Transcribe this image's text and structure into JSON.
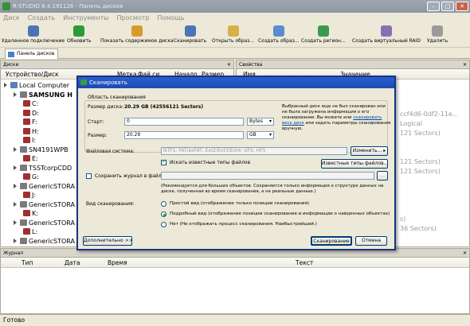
{
  "window": {
    "title": "R-STUDIO 8.4.191126 - Панель дисков",
    "min": "–",
    "max": "□",
    "close": "✕"
  },
  "menu": [
    "Диск",
    "Создать",
    "Инструменты",
    "Просмотр",
    "Помощь"
  ],
  "toolbar": [
    {
      "label": "Удаленное подключение",
      "icon": "remote-connect-icon",
      "color": "#4a74b8"
    },
    {
      "label": "Обновить",
      "icon": "refresh-icon",
      "color": "#2e9b38"
    },
    {
      "label": "Показать содержимое диска",
      "icon": "show-content-icon",
      "color": "#d89a2a"
    },
    {
      "label": "Сканировать",
      "icon": "scan-icon",
      "color": "#4a74b8"
    },
    {
      "label": "Открыть образ...",
      "icon": "open-image-icon",
      "color": "#d6b04a"
    },
    {
      "label": "Создать образ...",
      "icon": "create-image-icon",
      "color": "#5a8cd0"
    },
    {
      "label": "Создать регион...",
      "icon": "create-region-icon",
      "color": "#3c9a4c"
    },
    {
      "label": "Создать виртуальный RAID",
      "icon": "virtual-raid-icon",
      "color": "#8a6fb6"
    },
    {
      "label": "Удалить",
      "icon": "delete-icon",
      "color": "#9a9a9a"
    }
  ],
  "tab": "Панель дисков",
  "disks_pane": {
    "title": "Диски",
    "columns": [
      "Устройство/Диск",
      "Метка",
      "Фай.си.",
      "Начало",
      "Размер"
    ]
  },
  "tree": [
    {
      "label": "Local Computer",
      "level": 0,
      "color": "#5a7fb5"
    },
    {
      "label": "SAMSUNG H",
      "level": 1,
      "color": "#7a7a7a",
      "bold": true
    },
    {
      "label": "C:",
      "level": 2,
      "color": "#a03030"
    },
    {
      "label": "D:",
      "level": 2,
      "color": "#a03030"
    },
    {
      "label": "F:",
      "level": 2,
      "color": "#a03030"
    },
    {
      "label": "H:",
      "level": 2,
      "color": "#a03030"
    },
    {
      "label": "I:",
      "level": 2,
      "color": "#a03030"
    },
    {
      "label": "SN4191WPB",
      "level": 1,
      "color": "#7a7a7a"
    },
    {
      "label": "E:",
      "level": 2,
      "color": "#a03030"
    },
    {
      "label": "TSSTcorpCDD",
      "level": 1,
      "color": "#7a7a7a"
    },
    {
      "label": "G:",
      "level": 2,
      "color": "#a03030"
    },
    {
      "label": "GenericSTORA",
      "level": 1,
      "color": "#7a7a7a"
    },
    {
      "label": "J:",
      "level": 2,
      "color": "#a03030"
    },
    {
      "label": "GenericSTORA",
      "level": 1,
      "color": "#7a7a7a"
    },
    {
      "label": "K:",
      "level": 2,
      "color": "#a03030"
    },
    {
      "label": "GenericSTORA",
      "level": 1,
      "color": "#7a7a7a"
    },
    {
      "label": "L:",
      "level": 2,
      "color": "#a03030"
    },
    {
      "label": "GenericSTORA",
      "level": 1,
      "color": "#7a7a7a"
    }
  ],
  "props_pane": {
    "title": "Свойства",
    "columns": [
      "Имя",
      "Значение"
    ]
  },
  "props_visible": [
    "ccf4d6-0df2-11e...",
    "Logical",
    "121 Sectors)",
    "121 Sectors)",
    "121 Sectors)",
    "s)",
    "36 Sectors)"
  ],
  "journal": {
    "title": "Журнал",
    "columns": [
      "Тип",
      "Дата",
      "Время",
      "Текст"
    ]
  },
  "status": "Готово",
  "dialog": {
    "title": "Сканировать",
    "group_label": "Область сканирования",
    "disk_size_label": "Размер диска:",
    "disk_size_value": "20.29 GB (42556121 Sectors)",
    "start_label": "Старт:",
    "start_value": "0",
    "start_unit": "Bytes",
    "size_label": "Размер:",
    "size_value": "20.29",
    "size_unit": "GB",
    "note_part1": "Выбранный диск еще не был сканирован или не была загружена информация о его сканировании. Вы можете или",
    "note_link": "сканировать весь диск",
    "note_part2": "или задать параметры сканирования вручную.",
    "fs_label": "Файловая система:",
    "fs_value": "NTFS; FAT/exFAT; Ext2/Ext3/Ext4; UFS; HFS",
    "change_button": "Изменить...",
    "search_known": "Искать известные типы файлов",
    "known_types_button": "Известные типы файлов...",
    "save_log_label": "Сохранить журнал в файл:",
    "browse_button": "...",
    "recommend_note": "(Рекомендуется для больших объектов. Сохраняется только информация о структуре данных на диске, полученная во время сканирования, а не реальные данные.)",
    "view_label": "Вид сканирования:",
    "view_options": [
      {
        "label": "Простой вид (отображение только позиции сканирования)",
        "selected": false
      },
      {
        "label": "Подробный вид (отображение позиции сканирования и информации о найденных объектах)",
        "selected": true
      },
      {
        "label": "Нет (Не отображать процесс сканирования. Наибыстрейший.)",
        "selected": false
      }
    ],
    "more_button": "Дополнительно >>",
    "scan_button": "Сканирование",
    "cancel_button": "Отмена"
  }
}
